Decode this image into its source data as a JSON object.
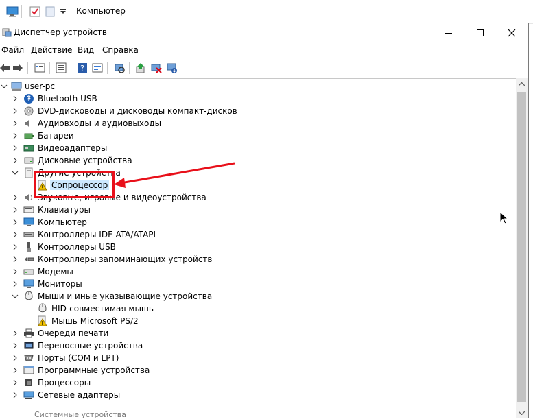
{
  "explorer": {
    "title": "Компьютер"
  },
  "window": {
    "title": "Диспетчер устройств",
    "minimize_label": "—",
    "maximize_label": "☐",
    "close_label": "✕"
  },
  "menu": [
    "Файл",
    "Действие",
    "Вид",
    "Справка"
  ],
  "toolbar_icons": [
    "back-icon",
    "forward-icon",
    "properties-icon",
    "list-icon",
    "help-icon",
    "resources-icon",
    "scan-icon",
    "update-driver-icon",
    "disable-device-icon",
    "uninstall-device-icon"
  ],
  "tree": {
    "root": "user-pc",
    "items": [
      {
        "label": "Bluetooth USB",
        "expanded": false,
        "icon": "bluetooth-icon"
      },
      {
        "label": "DVD-дисководы и дисководы компакт-дисков",
        "expanded": false,
        "icon": "dvd-icon"
      },
      {
        "label": "Аудиовходы и аудиовыходы",
        "expanded": false,
        "icon": "speaker-icon"
      },
      {
        "label": "Батареи",
        "expanded": false,
        "icon": "battery-icon"
      },
      {
        "label": "Видеоадаптеры",
        "expanded": false,
        "icon": "display-adapter-icon"
      },
      {
        "label": "Дисковые устройства",
        "expanded": false,
        "icon": "disk-drive-icon"
      },
      {
        "label": "Другие устройства",
        "expanded": true,
        "icon": "unknown-device-icon"
      },
      {
        "label": "Сопроцессор",
        "child": true,
        "warning": true,
        "selected": true,
        "icon": "warning-device-icon"
      },
      {
        "label": "Звуковые, игровые и видеоустройства",
        "expanded": false,
        "icon": "sound-icon"
      },
      {
        "label": "Клавиатуры",
        "expanded": false,
        "icon": "keyboard-icon"
      },
      {
        "label": "Компьютер",
        "expanded": false,
        "icon": "computer-icon"
      },
      {
        "label": "Контроллеры IDE ATA/ATAPI",
        "expanded": false,
        "icon": "ide-controller-icon"
      },
      {
        "label": "Контроллеры USB",
        "expanded": false,
        "icon": "usb-icon"
      },
      {
        "label": "Контроллеры запоминающих устройств",
        "expanded": false,
        "icon": "storage-controller-icon"
      },
      {
        "label": "Модемы",
        "expanded": false,
        "icon": "modem-icon"
      },
      {
        "label": "Мониторы",
        "expanded": false,
        "icon": "monitor-icon"
      },
      {
        "label": "Мыши и иные указывающие устройства",
        "expanded": true,
        "icon": "mouse-icon"
      },
      {
        "label": "HID-совместимая мышь",
        "child": true,
        "icon": "mouse-icon"
      },
      {
        "label": "Мышь Microsoft PS/2",
        "child": true,
        "warning": true,
        "icon": "warning-device-icon"
      },
      {
        "label": "Очереди печати",
        "expanded": false,
        "icon": "printer-icon"
      },
      {
        "label": "Переносные устройства",
        "expanded": false,
        "icon": "portable-device-icon"
      },
      {
        "label": "Порты (COM и LPT)",
        "expanded": false,
        "icon": "port-icon"
      },
      {
        "label": "Программные устройства",
        "expanded": false,
        "icon": "software-device-icon"
      },
      {
        "label": "Процессоры",
        "expanded": false,
        "icon": "processor-icon"
      },
      {
        "label": "Сетевые адаптеры",
        "expanded": false,
        "icon": "network-adapter-icon"
      }
    ]
  },
  "bottom_peek": "Системные устройства",
  "colors": {
    "selection": "#cce8ff",
    "annotation": "#e8101a",
    "warning": "#f2c200"
  }
}
